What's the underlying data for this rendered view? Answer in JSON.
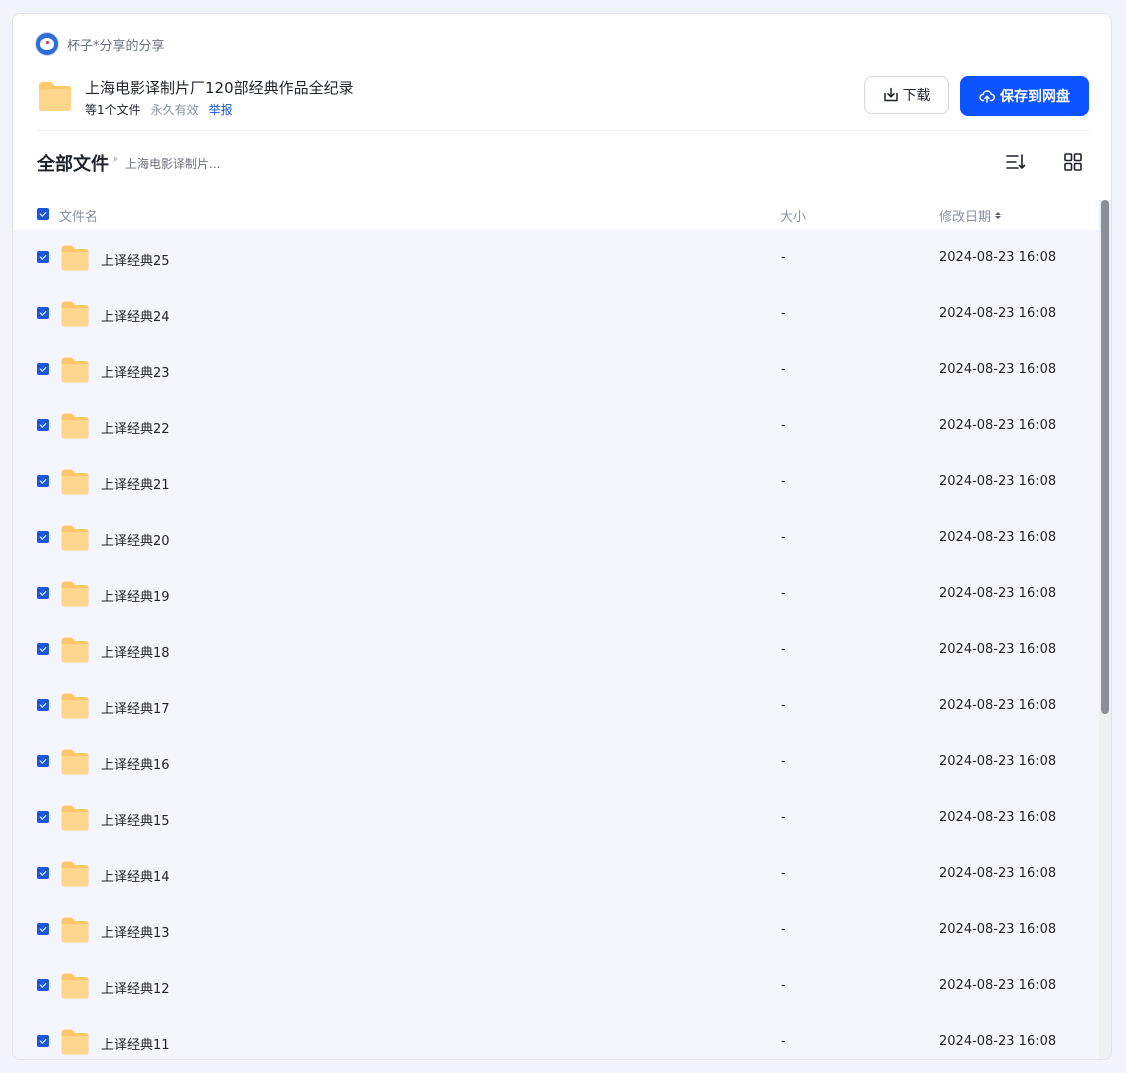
{
  "sharer": {
    "name": "杯子*分享的分享"
  },
  "share": {
    "title": "上海电影译制片厂120部经典作品全纪录",
    "count": "等1个文件",
    "expire": "永久有效",
    "report": "举报",
    "download_label": "下载",
    "save_label": "保存到网盘"
  },
  "breadcrumb": {
    "root": "全部文件",
    "current": "上海电影译制片..."
  },
  "table": {
    "columns": {
      "name": "文件名",
      "size": "大小",
      "date": "修改日期"
    },
    "rows": [
      {
        "name": "上译经典25",
        "size": "-",
        "date": "2024-08-23 16:08"
      },
      {
        "name": "上译经典24",
        "size": "-",
        "date": "2024-08-23 16:08"
      },
      {
        "name": "上译经典23",
        "size": "-",
        "date": "2024-08-23 16:08"
      },
      {
        "name": "上译经典22",
        "size": "-",
        "date": "2024-08-23 16:08"
      },
      {
        "name": "上译经典21",
        "size": "-",
        "date": "2024-08-23 16:08"
      },
      {
        "name": "上译经典20",
        "size": "-",
        "date": "2024-08-23 16:08"
      },
      {
        "name": "上译经典19",
        "size": "-",
        "date": "2024-08-23 16:08"
      },
      {
        "name": "上译经典18",
        "size": "-",
        "date": "2024-08-23 16:08"
      },
      {
        "name": "上译经典17",
        "size": "-",
        "date": "2024-08-23 16:08"
      },
      {
        "name": "上译经典16",
        "size": "-",
        "date": "2024-08-23 16:08"
      },
      {
        "name": "上译经典15",
        "size": "-",
        "date": "2024-08-23 16:08"
      },
      {
        "name": "上译经典14",
        "size": "-",
        "date": "2024-08-23 16:08"
      },
      {
        "name": "上译经典13",
        "size": "-",
        "date": "2024-08-23 16:08"
      },
      {
        "name": "上译经典12",
        "size": "-",
        "date": "2024-08-23 16:08"
      },
      {
        "name": "上译经典11",
        "size": "-",
        "date": "2024-08-23 16:08"
      }
    ]
  },
  "icons": {
    "folder": "folder-icon",
    "download": "download-icon",
    "save": "cloud-upload-icon",
    "sort": "sort-icon",
    "grid_view": "grid-view-icon"
  },
  "colors": {
    "accent": "#0d53ff",
    "folder": "#ffc86b",
    "list_bg": "#f5f6fd"
  }
}
